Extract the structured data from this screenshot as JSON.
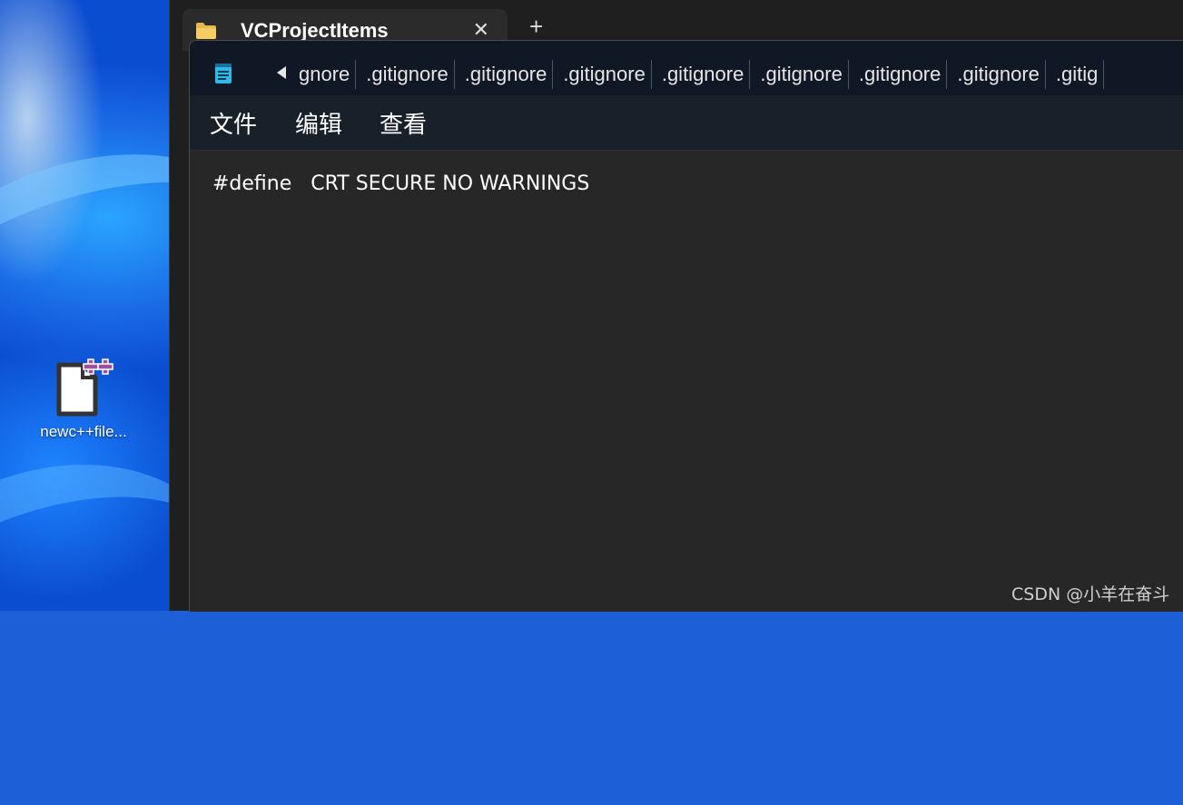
{
  "desktop": {
    "icon_label": "newc++file..."
  },
  "explorer": {
    "tab_title": "VCProjectItems",
    "tab_close": "✕",
    "new_tab": "+"
  },
  "notepad": {
    "tabs": [
      "gnore",
      ".gitignore",
      ".gitignore",
      ".gitignore",
      ".gitignore",
      ".gitignore",
      ".gitignore",
      ".gitignore",
      ".gitig"
    ],
    "menu": {
      "file": "文件",
      "edit": "编辑",
      "view": "查看"
    },
    "content": "#define   CRT SECURE NO WARNINGS"
  },
  "watermark": "CSDN @小羊在奋斗",
  "colors": {
    "titlebar": "#101825",
    "menubar": "#18202a",
    "editor_bg": "#272727",
    "accent_notepad_icon": "#2fb8e8",
    "cpp_plus": "#a0509a"
  }
}
